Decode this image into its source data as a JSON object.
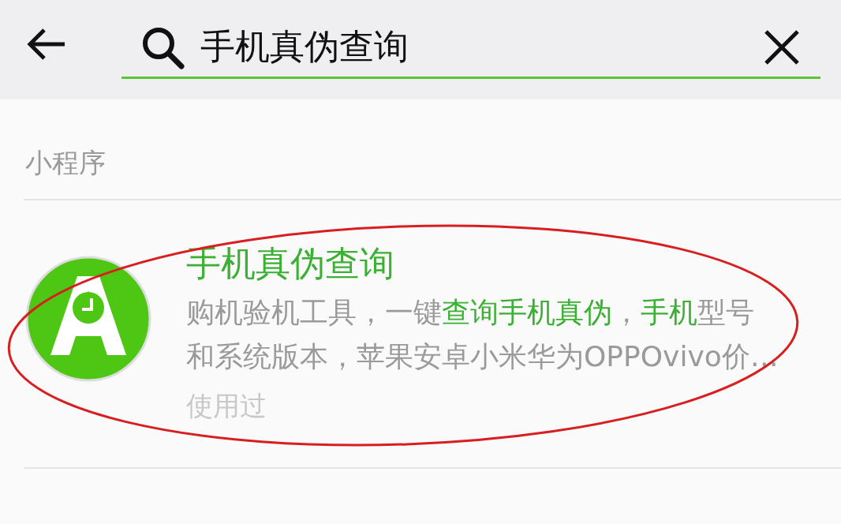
{
  "search": {
    "value": "手机真伪查询"
  },
  "section_title": "小程序",
  "results": [
    {
      "title": "手机真伪查询",
      "highlighted": true,
      "description_lines": [
        [
          {
            "text": "购机验机工具，一键",
            "highlight": false
          },
          {
            "text": "查询手机真伪",
            "highlight": true
          },
          {
            "text": "，",
            "highlight": false
          },
          {
            "text": "手机",
            "highlight": true
          },
          {
            "text": "型号",
            "highlight": false
          }
        ],
        [
          {
            "text": "和系统版本，苹果安卓小米华为OPPOvivo价…",
            "highlight": false
          }
        ]
      ],
      "status": "使用过"
    }
  ]
}
